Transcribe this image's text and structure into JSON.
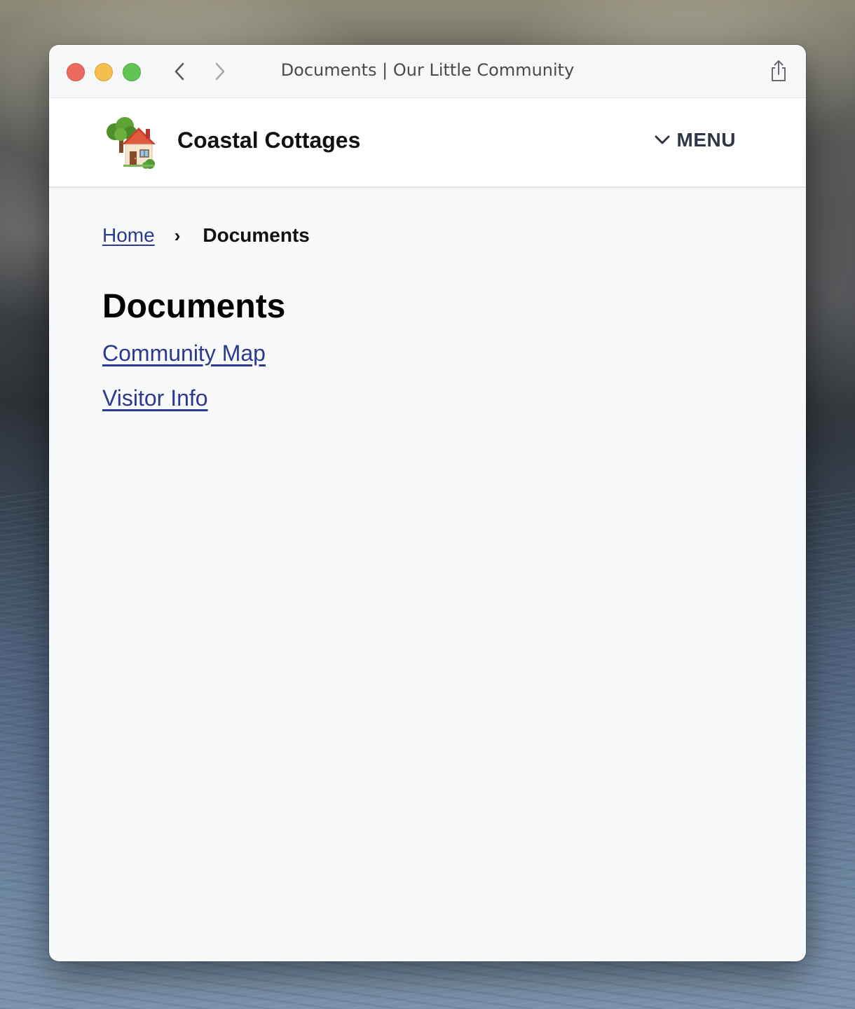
{
  "browser": {
    "window_title": "Documents | Our Little Community"
  },
  "site": {
    "name": "Coastal Cottages",
    "logo_icon": "house-with-garden-icon",
    "menu_label": "MENU"
  },
  "breadcrumb": {
    "home_label": "Home",
    "separator": "›",
    "current_label": "Documents"
  },
  "page": {
    "title": "Documents",
    "documents": [
      {
        "label": "Community Map"
      },
      {
        "label": "Visitor Info"
      }
    ]
  },
  "colors": {
    "link": "#2b3a8f",
    "menu_text": "#2f3747",
    "page_background": "#f8f9fb"
  }
}
